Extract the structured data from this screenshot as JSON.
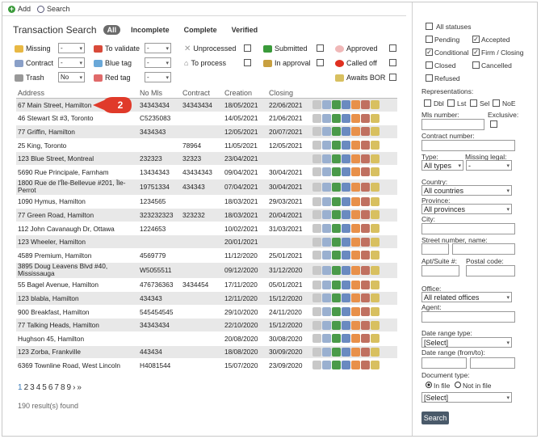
{
  "toolbar": {
    "add": "Add",
    "search": "Search"
  },
  "header": {
    "title": "Transaction Search",
    "pills": [
      "All",
      "Incomplete",
      "Complete",
      "Verified"
    ]
  },
  "filters": {
    "missing": "Missing",
    "contract": "Contract",
    "trash": "Trash",
    "trash_value": "No",
    "to_validate": "To validate",
    "blue_tag": "Blue tag",
    "red_tag": "Red tag",
    "unprocessed": "Unprocessed",
    "to_process": "To process",
    "submitted": "Submitted",
    "in_approval": "In approval",
    "approved": "Approved",
    "called_off": "Called off",
    "awaits_bor": "Awaits BOR",
    "dash": "-"
  },
  "table": {
    "columns": [
      "Address",
      "No Mls",
      "Contract",
      "Creation",
      "Closing"
    ],
    "rows": [
      {
        "address": "67 Main Street, Hamilton",
        "mls": "34343434",
        "contract": "34343434",
        "creation": "18/05/2021",
        "closing": "22/06/2021"
      },
      {
        "address": "46 Stewart St #3, Toronto",
        "mls": "C5235083",
        "contract": "",
        "creation": "14/05/2021",
        "closing": "21/06/2021"
      },
      {
        "address": "77 Griffin, Hamilton",
        "mls": "3434343",
        "contract": "",
        "creation": "12/05/2021",
        "closing": "20/07/2021"
      },
      {
        "address": "25 King, Toronto",
        "mls": "",
        "contract": "78964",
        "creation": "11/05/2021",
        "closing": "12/05/2021"
      },
      {
        "address": "123 Blue Street, Montreal",
        "mls": "232323",
        "contract": "32323",
        "creation": "23/04/2021",
        "closing": ""
      },
      {
        "address": "5690 Rue Principale, Farnham",
        "mls": "13434343",
        "contract": "43434343",
        "creation": "09/04/2021",
        "closing": "30/04/2021"
      },
      {
        "address": "1800 Rue de l'Île-Bellevue #201, Île-Perrot",
        "mls": "19751334",
        "contract": "434343",
        "creation": "07/04/2021",
        "closing": "30/04/2021"
      },
      {
        "address": "1090 Hymus, Hamilton",
        "mls": "1234565",
        "contract": "",
        "creation": "18/03/2021",
        "closing": "29/03/2021"
      },
      {
        "address": "77 Green Road, Hamilton",
        "mls": "323232323",
        "contract": "323232",
        "creation": "18/03/2021",
        "closing": "20/04/2021"
      },
      {
        "address": "112 John Cavanaugh Dr, Ottawa",
        "mls": "1224653",
        "contract": "",
        "creation": "10/02/2021",
        "closing": "31/03/2021"
      },
      {
        "address": "123 Wheeler, Hamilton",
        "mls": "",
        "contract": "",
        "creation": "20/01/2021",
        "closing": ""
      },
      {
        "address": "4589 Premium, Hamilton",
        "mls": "4569779",
        "contract": "",
        "creation": "11/12/2020",
        "closing": "25/01/2021"
      },
      {
        "address": "3895 Doug Leavens Blvd #40, Mississauga",
        "mls": "W5055511",
        "contract": "",
        "creation": "09/12/2020",
        "closing": "31/12/2020"
      },
      {
        "address": "55 Bagel Avenue, Hamilton",
        "mls": "476736363",
        "contract": "3434454",
        "creation": "17/11/2020",
        "closing": "05/01/2021"
      },
      {
        "address": "123 blabla, Hamilton",
        "mls": "434343",
        "contract": "",
        "creation": "12/11/2020",
        "closing": "15/12/2020"
      },
      {
        "address": "900 Breakfast, Hamilton",
        "mls": "545454545",
        "contract": "",
        "creation": "29/10/2020",
        "closing": "24/11/2020"
      },
      {
        "address": "77 Talking Heads, Hamilton",
        "mls": "34343434",
        "contract": "",
        "creation": "22/10/2020",
        "closing": "15/12/2020"
      },
      {
        "address": "Hughson 45, Hamilton",
        "mls": "",
        "contract": "",
        "creation": "20/08/2020",
        "closing": "30/08/2020"
      },
      {
        "address": "123 Zorba, Frankville",
        "mls": "443434",
        "contract": "",
        "creation": "18/08/2020",
        "closing": "30/09/2020"
      },
      {
        "address": "6369 Townline Road, West Lincoln",
        "mls": "H4081544",
        "contract": "",
        "creation": "15/07/2020",
        "closing": "23/09/2020"
      }
    ]
  },
  "callout": "2",
  "pager": {
    "pages": [
      "1",
      "2",
      "3",
      "4",
      "5",
      "6",
      "7",
      "8",
      "9"
    ],
    "next": "›",
    "last": "»"
  },
  "result_count": "190 result(s) found",
  "side": {
    "statuses": {
      "all": "All statuses",
      "pending": "Pending",
      "accepted": "Accepted",
      "conditional": "Conditional",
      "firm": "Firm / Closing",
      "closed": "Closed",
      "cancelled": "Cancelled",
      "refused": "Refused"
    },
    "representations": "Representations:",
    "reps": [
      "Dbl",
      "Lst",
      "Sel",
      "NoE"
    ],
    "mls_number": "Mls number:",
    "exclusive": "Exclusive:",
    "contract_number": "Contract number:",
    "type": "Type:",
    "type_value": "All types",
    "missing_legal": "Missing legal:",
    "missing_legal_value": "-",
    "country": "Country:",
    "country_value": "All countries",
    "province": "Province:",
    "province_value": "All provinces",
    "city": "City:",
    "street": "Street number, name:",
    "apt": "Apt/Suite #:",
    "postal": "Postal code:",
    "office": "Office:",
    "office_value": "All related offices",
    "agent": "Agent:",
    "date_range_type": "Date range type:",
    "date_range_value": "[Select]",
    "date_range_from_to": "Date range (from/to):",
    "document_type": "Document type:",
    "in_file": "In file",
    "not_in_file": "Not in file",
    "doc_select": "[Select]",
    "search_button": "Search"
  }
}
